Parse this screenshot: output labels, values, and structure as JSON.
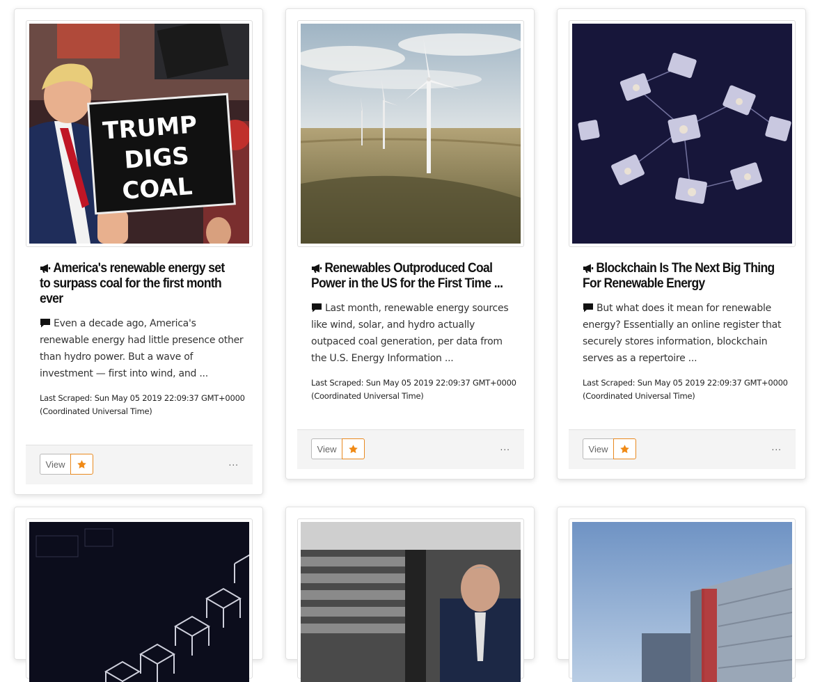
{
  "cards": [
    {
      "title": "America's renewable energy set to surpass coal for the first month ever",
      "description": "Even a decade ago, America's renewable energy had little presence other than hydro power. But a wave of investment — first into wind, and ...",
      "scraped": "Last Scraped: Sun May 05 2019 22:09:37 GMT+0000 (Coordinated Universal Time)",
      "view_label": "View",
      "more_label": "...",
      "image_text": [
        "TRUMP",
        "DIGS",
        "COAL"
      ]
    },
    {
      "title": "Renewables Outproduced Coal Power in the US for the First Time ...",
      "description": "Last month, renewable energy sources like wind, solar, and hydro actually outpaced coal generation, per data from the U.S. Energy Information ...",
      "scraped": "Last Scraped: Sun May 05 2019 22:09:37 GMT+0000 (Coordinated Universal Time)",
      "view_label": "View",
      "more_label": "..."
    },
    {
      "title": "Blockchain Is The Next Big Thing For Renewable Energy",
      "description": "But what does it mean for renewable energy? Essentially an online register that securely stores information, blockchain serves as a repertoire ...",
      "scraped": "Last Scraped: Sun May 05 2019 22:09:37 GMT+0000 (Coordinated Universal Time)",
      "view_label": "View",
      "more_label": "..."
    }
  ],
  "icons": {
    "title": "megaphone-icon",
    "description": "comment-icon",
    "favorite": "star-icon"
  },
  "colors": {
    "accent": "#e8891f",
    "footer_bg": "#f4f4f4"
  }
}
